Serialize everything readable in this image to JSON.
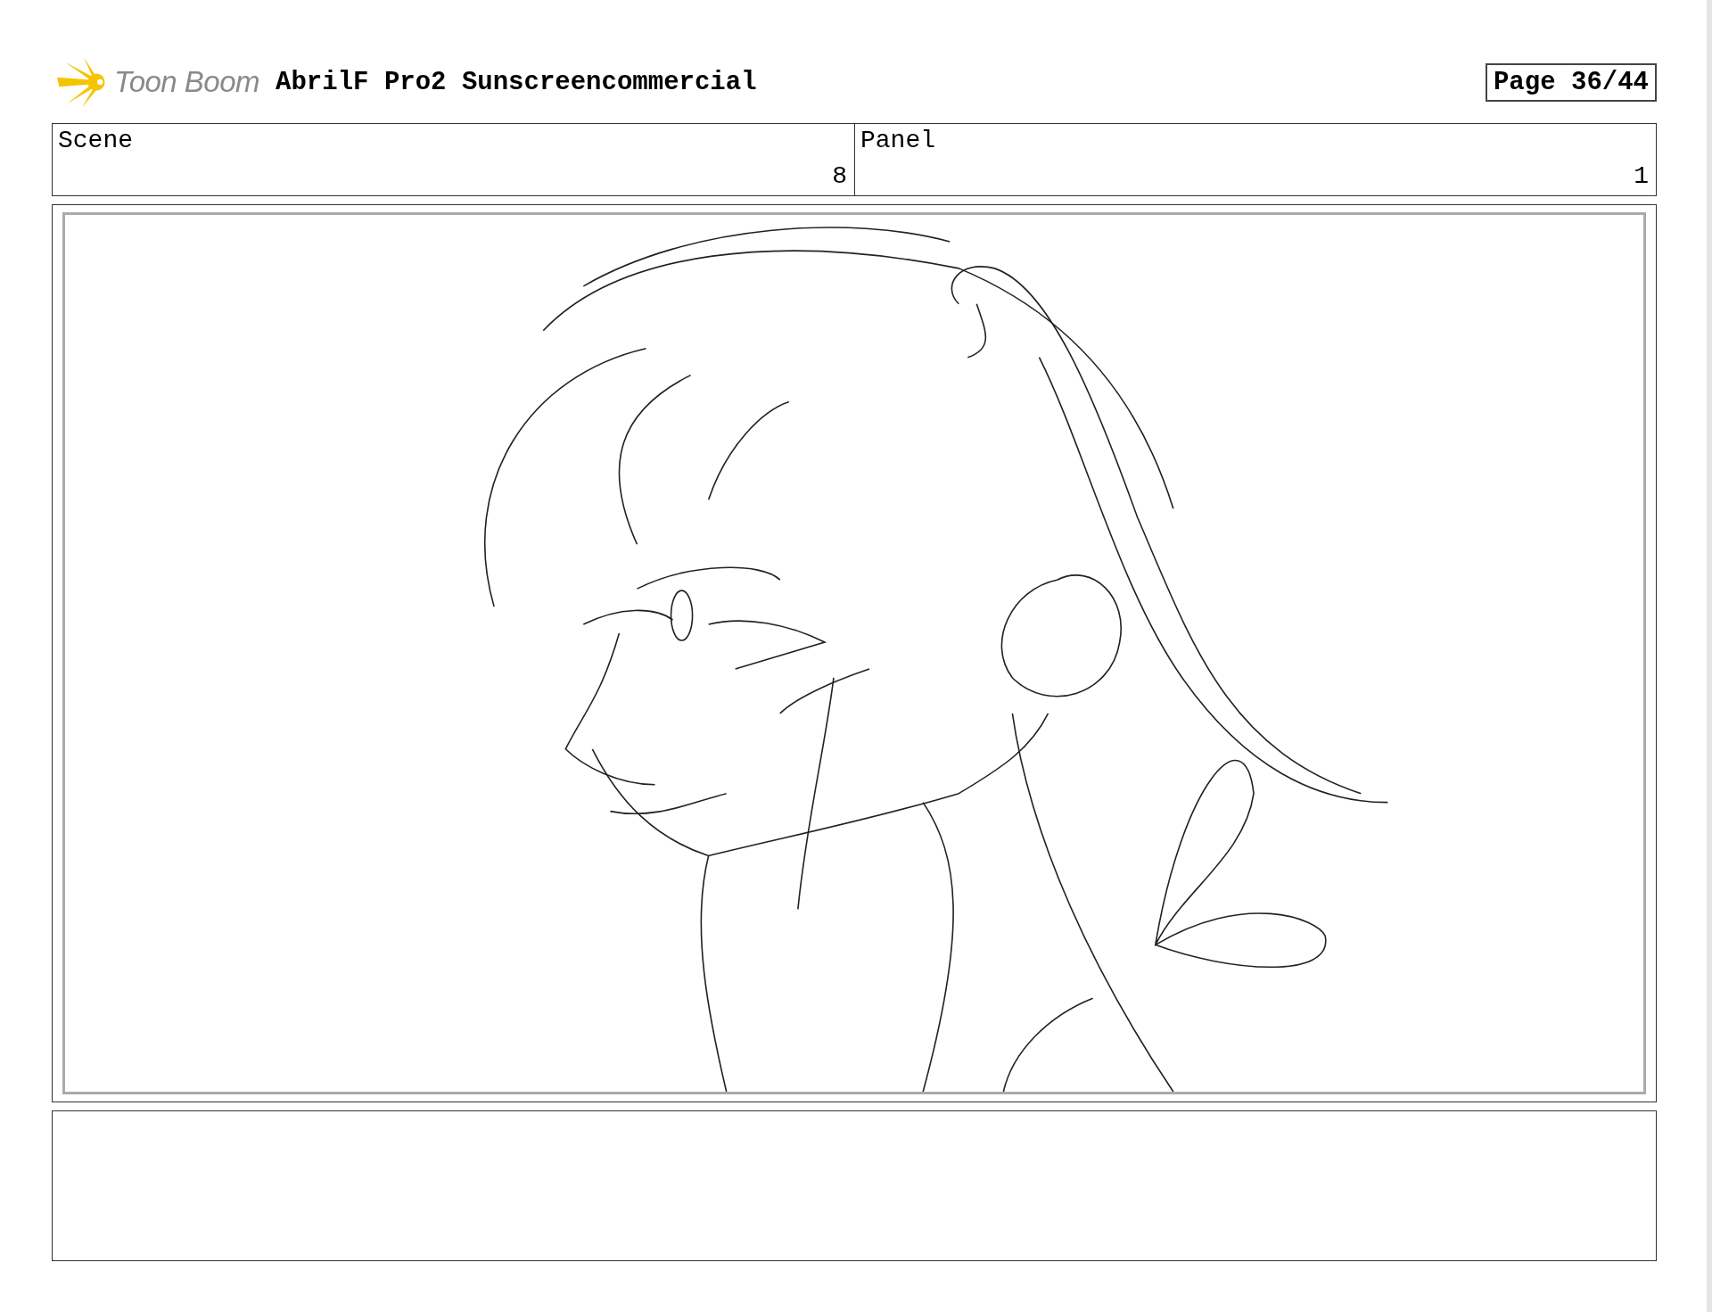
{
  "header": {
    "logo_text": "Toon Boom",
    "title": "AbrilF Pro2 Sunscreencommercial",
    "page": "Page 36/44"
  },
  "info": {
    "scene_label": "Scene",
    "scene": "8",
    "panel_label": "Panel",
    "panel": "1"
  }
}
